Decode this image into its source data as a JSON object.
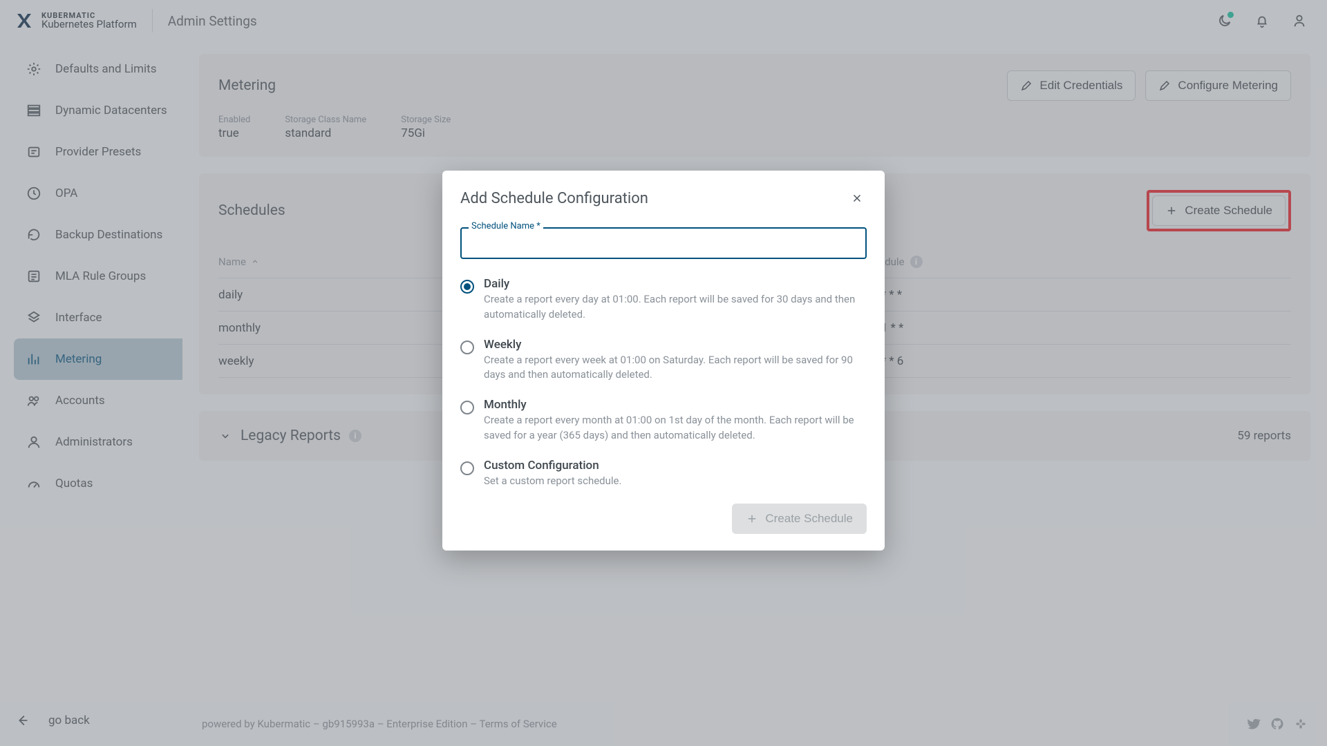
{
  "header": {
    "brand_top": "KUBERMATIC",
    "brand_bottom": "Kubernetes Platform",
    "page_title": "Admin Settings"
  },
  "sidebar": {
    "items": [
      {
        "label": "Defaults and Limits",
        "icon": "gear-icon"
      },
      {
        "label": "Dynamic Datacenters",
        "icon": "list-icon"
      },
      {
        "label": "Provider Presets",
        "icon": "preset-icon"
      },
      {
        "label": "OPA",
        "icon": "policy-icon"
      },
      {
        "label": "Backup Destinations",
        "icon": "restore-icon"
      },
      {
        "label": "MLA Rule Groups",
        "icon": "rules-icon"
      },
      {
        "label": "Interface",
        "icon": "interface-icon"
      },
      {
        "label": "Metering",
        "icon": "metering-icon",
        "active": true
      },
      {
        "label": "Accounts",
        "icon": "accounts-icon"
      },
      {
        "label": "Administrators",
        "icon": "admin-icon"
      },
      {
        "label": "Quotas",
        "icon": "quotas-icon"
      }
    ],
    "go_back": "go back"
  },
  "metering": {
    "title": "Metering",
    "edit_credentials": "Edit Credentials",
    "configure": "Configure Metering",
    "enabled_label": "Enabled",
    "enabled_value": "true",
    "storage_class_label": "Storage Class Name",
    "storage_class_value": "standard",
    "storage_size_label": "Storage Size",
    "storage_size_value": "75Gi"
  },
  "schedules": {
    "title": "Schedules",
    "create_button": "Create Schedule",
    "col_name": "Name",
    "col_schedule": "Schedule",
    "rows": [
      {
        "name": "daily",
        "schedule": "0 1 * * *"
      },
      {
        "name": "monthly",
        "schedule": "0 1 1 * *"
      },
      {
        "name": "weekly",
        "schedule": "0 1 * * 6"
      }
    ]
  },
  "legacy": {
    "title": "Legacy Reports",
    "count": "59 reports"
  },
  "footer": {
    "line": "powered by Kubermatic  –  gb915993a  –   Enterprise Edition  –   Terms of Service"
  },
  "modal": {
    "title": "Add Schedule Configuration",
    "field_label": "Schedule Name",
    "field_required": "*",
    "field_value": "",
    "options": [
      {
        "title": "Daily",
        "desc": "Create a report every day at 01:00. Each report will be saved for 30 days and then automatically deleted.",
        "selected": true
      },
      {
        "title": "Weekly",
        "desc": "Create a report every week at 01:00 on Saturday. Each report will be saved for 90 days and then automatically deleted.",
        "selected": false
      },
      {
        "title": "Monthly",
        "desc": "Create a report every month at 01:00 on 1st day of the month. Each report will be saved for a year (365 days) and then automatically deleted.",
        "selected": false
      },
      {
        "title": "Custom Configuration",
        "desc": "Set a custom report schedule.",
        "selected": false
      }
    ],
    "submit": "Create Schedule"
  }
}
